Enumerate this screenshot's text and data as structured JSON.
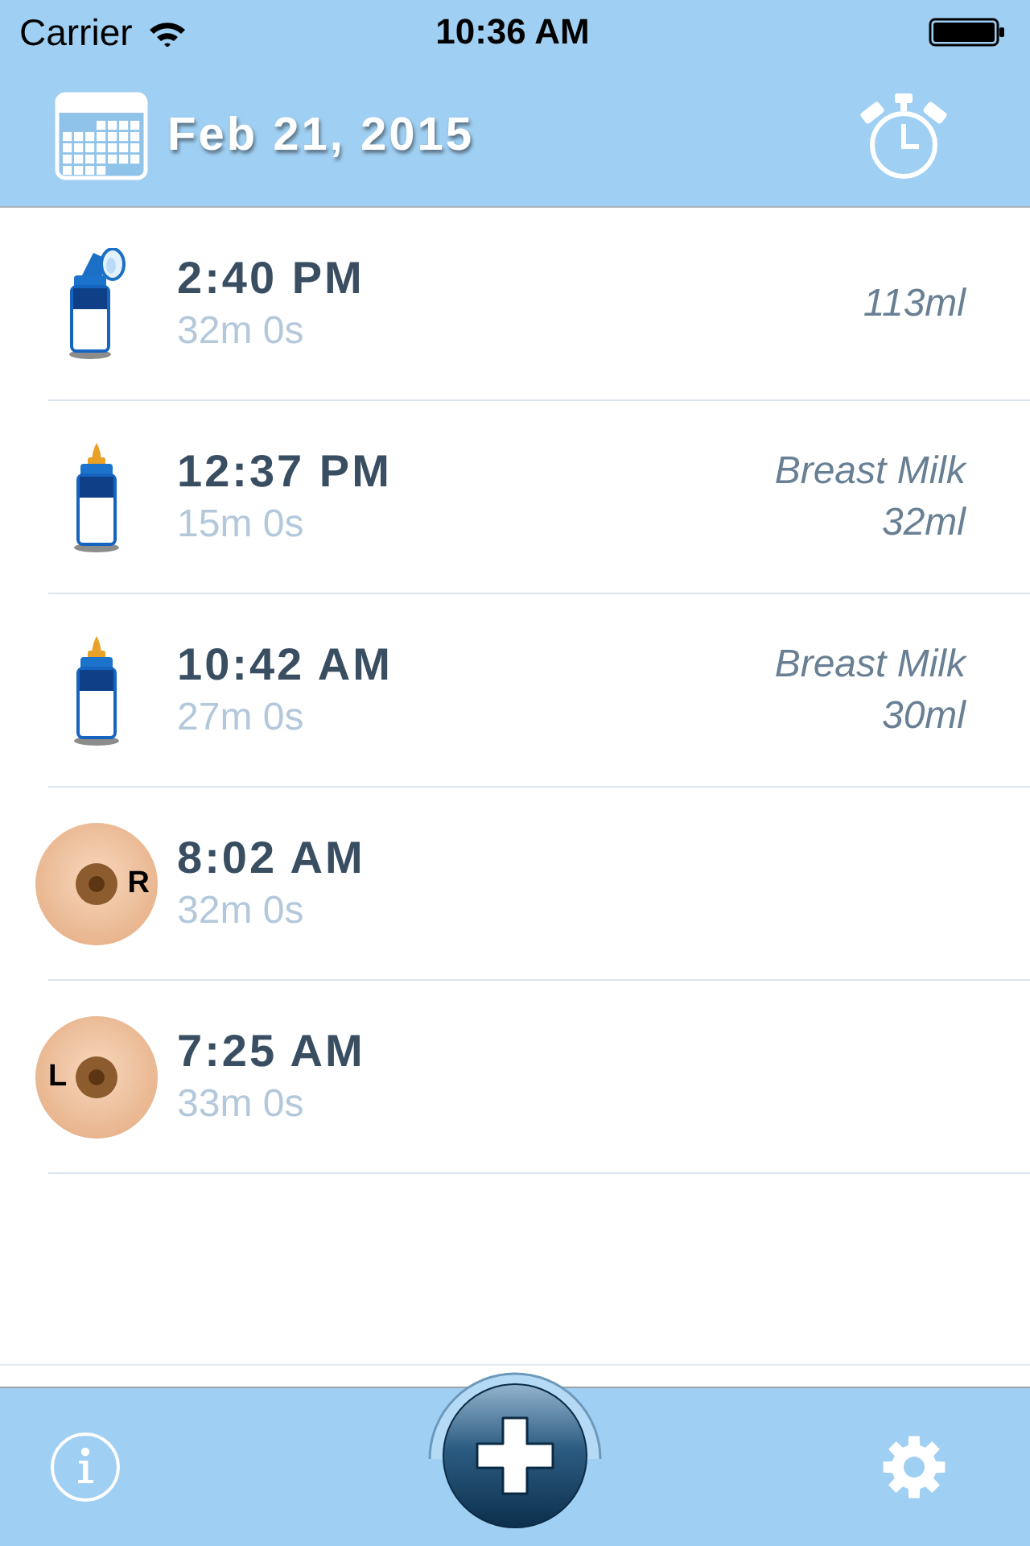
{
  "status_bar": {
    "carrier": "Carrier",
    "time": "10:36 AM"
  },
  "header": {
    "date": "Feb 21, 2015"
  },
  "feedings": [
    {
      "kind": "pump",
      "time": "2:40 PM",
      "duration": "32m 0s",
      "amount": "113ml"
    },
    {
      "kind": "bottle",
      "time": "12:37 PM",
      "duration": "15m 0s",
      "milk_type": "Breast Milk",
      "amount": "32ml"
    },
    {
      "kind": "bottle",
      "time": "10:42 AM",
      "duration": "27m 0s",
      "milk_type": "Breast Milk",
      "amount": "30ml"
    },
    {
      "kind": "breast",
      "right_side": true,
      "side_label": "R",
      "time": "8:02 AM",
      "duration": "32m 0s"
    },
    {
      "kind": "breast",
      "right_side": false,
      "side_label": "L",
      "time": "7:25 AM",
      "duration": "33m 0s"
    }
  ]
}
